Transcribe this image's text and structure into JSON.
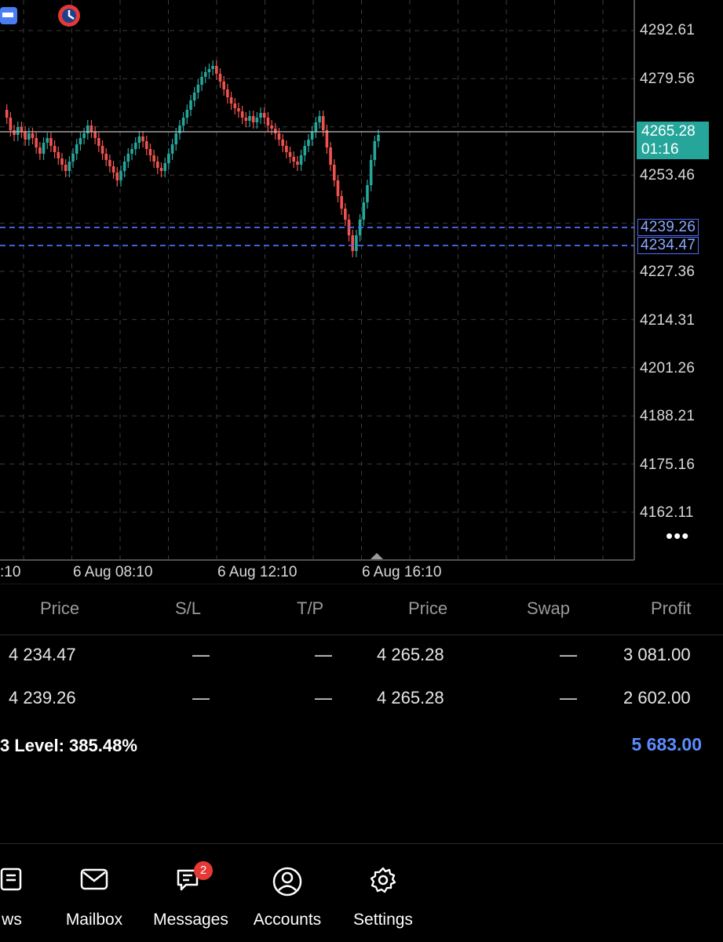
{
  "chart": {
    "price_levels": [
      "4292.61",
      "4279.56",
      "4253.46",
      "4227.36",
      "4214.31",
      "4201.26",
      "4188.21",
      "4175.16",
      "4162.11"
    ],
    "current_price": "4265.28",
    "countdown": "01:16",
    "order_levels": [
      "4239.26",
      "4234.47"
    ],
    "time_labels": [
      ":10",
      "6 Aug 08:10",
      "6 Aug 12:10",
      "6 Aug 16:10"
    ],
    "colors": {
      "bull": "#26a69a",
      "bear": "#ef5350",
      "order_line": "#4d6cff",
      "grid": "#3a3a3a"
    },
    "more_icon": "ellipsis-icon"
  },
  "table": {
    "headers": [
      "Price",
      "S/L",
      "T/P",
      "Price",
      "Swap",
      "Profit"
    ],
    "rows": [
      {
        "open_price": "4 234.47",
        "sl": "—",
        "tp": "—",
        "price": "4 265.28",
        "swap": "—",
        "profit": "3 081.00"
      },
      {
        "open_price": "4 239.26",
        "sl": "—",
        "tp": "—",
        "price": "4 265.28",
        "swap": "—",
        "profit": "2 602.00"
      }
    ],
    "level_text": "3  Level:  385.48%",
    "total_profit": "5 683.00"
  },
  "nav": {
    "items": [
      {
        "label": "ws",
        "icon": "news-icon"
      },
      {
        "label": "Mailbox",
        "icon": "mail-icon"
      },
      {
        "label": "Messages",
        "icon": "chat-icon",
        "badge": "2"
      },
      {
        "label": "Accounts",
        "icon": "user-icon"
      },
      {
        "label": "Settings",
        "icon": "gear-icon"
      }
    ]
  }
}
